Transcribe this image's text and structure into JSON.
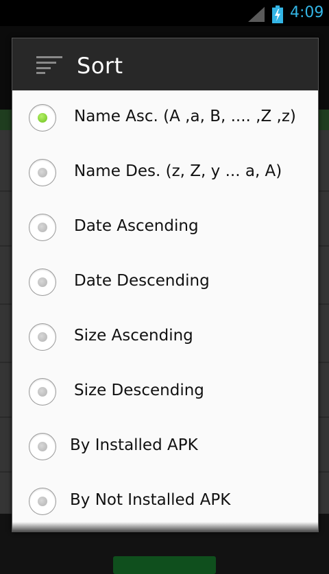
{
  "status_bar": {
    "time": "4:09",
    "signal_icon": "signal-icon",
    "battery_icon": "battery-charging-icon"
  },
  "dialog": {
    "title": "Sort",
    "title_icon": "sort-icon",
    "selected_index": 0,
    "options": [
      {
        "label": "Name Asc. (A ,a, B, .... ,Z ,z)",
        "checked": true
      },
      {
        "label": "Name Des. (z, Z, y ... a, A)",
        "checked": false
      },
      {
        "label": "Date Ascending",
        "checked": false
      },
      {
        "label": "Date Descending",
        "checked": false
      },
      {
        "label": "Size Ascending",
        "checked": false
      },
      {
        "label": "Size Descending",
        "checked": false
      },
      {
        "label": "By Installed APK",
        "checked": false
      },
      {
        "label": "By Not Installed APK",
        "checked": false
      }
    ]
  },
  "colors": {
    "accent": "#33b5e5",
    "radio_selected": "#7bd22a",
    "header_bg": "#282828"
  }
}
